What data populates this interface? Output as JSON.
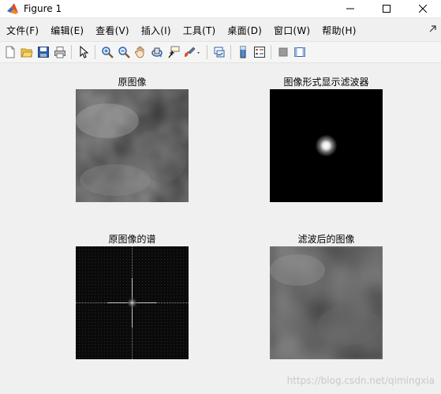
{
  "window": {
    "title": "Figure 1",
    "icon": "matlab-icon"
  },
  "menu": {
    "items": [
      {
        "label": "文件(F)",
        "name": "menu-file"
      },
      {
        "label": "编辑(E)",
        "name": "menu-edit"
      },
      {
        "label": "查看(V)",
        "name": "menu-view"
      },
      {
        "label": "插入(I)",
        "name": "menu-insert"
      },
      {
        "label": "工具(T)",
        "name": "menu-tools"
      },
      {
        "label": "桌面(D)",
        "name": "menu-desktop"
      },
      {
        "label": "窗口(W)",
        "name": "menu-window"
      },
      {
        "label": "帮助(H)",
        "name": "menu-help"
      }
    ]
  },
  "toolbar": {
    "icons": [
      "new-figure-icon",
      "open-file-icon",
      "save-icon",
      "print-icon",
      "select-arrow-icon",
      "zoom-in-icon",
      "zoom-out-icon",
      "pan-icon",
      "rotate-3d-icon",
      "data-cursor-icon",
      "brush-icon",
      "link-plot-icon",
      "colorbar-icon",
      "legend-icon",
      "hide-plot-tools-icon",
      "show-plot-tools-icon"
    ]
  },
  "axes": [
    {
      "title": "原图像",
      "name": "axes-original-image"
    },
    {
      "title": "图像形式显示滤波器",
      "name": "axes-filter-image"
    },
    {
      "title": "原图像的谱",
      "name": "axes-spectrum"
    },
    {
      "title": "滤波后的图像",
      "name": "axes-filtered-image"
    }
  ],
  "watermark": "https://blog.csdn.net/qimingxia",
  "colors": {
    "background": "#f0f0f0",
    "titlebar": "#ffffff"
  }
}
